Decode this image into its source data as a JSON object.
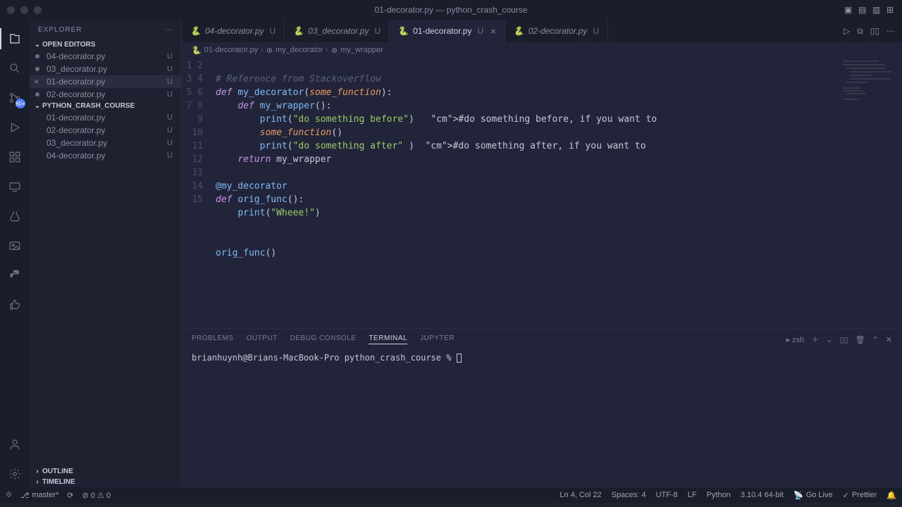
{
  "window": {
    "title": "01-decorator.py — python_crash_course"
  },
  "sidebar": {
    "title": "EXPLORER",
    "openEditors": {
      "label": "OPEN EDITORS",
      "items": [
        {
          "name": "04-decorator.py",
          "status": "U",
          "active": false
        },
        {
          "name": "03_decorator.py",
          "status": "U",
          "active": false
        },
        {
          "name": "01-decorator.py",
          "status": "U",
          "active": true
        },
        {
          "name": "02-decorator.py",
          "status": "U",
          "active": false
        }
      ]
    },
    "project": {
      "label": "PYTHON_CRASH_COURSE",
      "items": [
        {
          "name": "01-decorator.py",
          "status": "U"
        },
        {
          "name": "02-decorator.py",
          "status": "U"
        },
        {
          "name": "03_decorator.py",
          "status": "U"
        },
        {
          "name": "04-decorator.py",
          "status": "U"
        }
      ]
    },
    "outline": "OUTLINE",
    "timeline": "TIMELINE"
  },
  "tabs": [
    {
      "name": "04-decorator.py",
      "suffix": "U",
      "active": false
    },
    {
      "name": "03_decorator.py",
      "suffix": "U",
      "active": false
    },
    {
      "name": "01-decorator.py",
      "suffix": "U",
      "active": true
    },
    {
      "name": "02-decorator.py",
      "suffix": "U",
      "active": false
    }
  ],
  "breadcrumb": {
    "file": "01-decorator.py",
    "sym1": "my_decorator",
    "sym2": "my_wrapper"
  },
  "code": {
    "lines": [
      "",
      "# Reference from Stackoverflow",
      "def my_decorator(some_function):",
      "    def my_wrapper():",
      "        print(\"do something before\")   #do something before, if you want to",
      "        some_function()",
      "        print(\"do something after\" )  #do something after, if you want to",
      "    return my_wrapper",
      "",
      "@my_decorator",
      "def orig_func():",
      "    print(\"Wheee!\")",
      "",
      "",
      "orig_func()"
    ]
  },
  "panel": {
    "tabs": [
      "PROBLEMS",
      "OUTPUT",
      "DEBUG CONSOLE",
      "TERMINAL",
      "JUPYTER"
    ],
    "activeTab": "TERMINAL",
    "shellLabel": "zsh",
    "prompt": "brianhuynh@Brians-MacBook-Pro python_crash_course % "
  },
  "statusbar": {
    "branch": "master*",
    "sync": "⟳",
    "diag": "⊘ 0  ⚠ 0",
    "cursor": "Ln 4, Col 22",
    "spaces": "Spaces: 4",
    "encoding": "UTF-8",
    "eol": "LF",
    "lang": "Python",
    "interp": "3.10.4 64-bit",
    "golive": "Go Live",
    "prettier": "Prettier"
  },
  "scm_badge": "60+"
}
